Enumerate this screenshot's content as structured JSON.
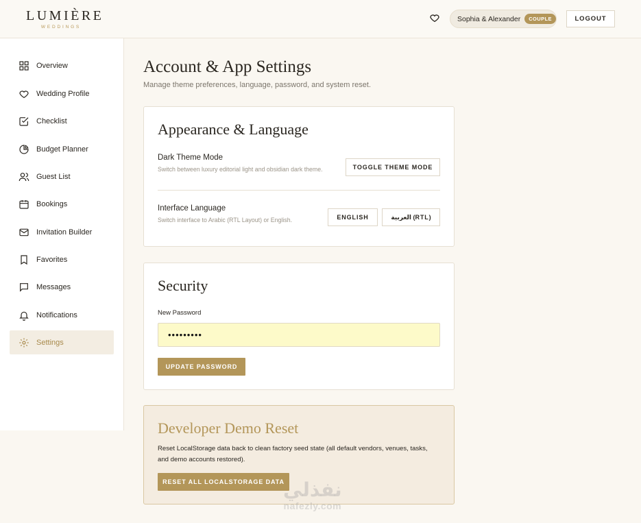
{
  "header": {
    "logo_main": "LUMIÈRE",
    "logo_sub": "WEDDINGS",
    "favorites_icon": "heart-icon",
    "user_name": "Sophia & Alexander",
    "user_badge": "COUPLE",
    "logout_label": "LOGOUT"
  },
  "sidebar": {
    "items": [
      {
        "label": "Overview",
        "icon": "grid-icon"
      },
      {
        "label": "Wedding Profile",
        "icon": "heart-icon"
      },
      {
        "label": "Checklist",
        "icon": "checkbox-icon"
      },
      {
        "label": "Budget Planner",
        "icon": "pie-chart-icon"
      },
      {
        "label": "Guest List",
        "icon": "users-icon"
      },
      {
        "label": "Bookings",
        "icon": "calendar-icon"
      },
      {
        "label": "Invitation Builder",
        "icon": "mail-icon"
      },
      {
        "label": "Favorites",
        "icon": "bookmark-icon"
      },
      {
        "label": "Messages",
        "icon": "message-icon"
      },
      {
        "label": "Notifications",
        "icon": "bell-icon"
      },
      {
        "label": "Settings",
        "icon": "gear-icon",
        "active": true
      }
    ]
  },
  "main": {
    "title": "Account & App Settings",
    "subtitle": "Manage theme preferences, language, password, and system reset.",
    "appearance": {
      "title": "Appearance & Language",
      "theme_label": "Dark Theme Mode",
      "theme_desc": "Switch between luxury editorial light and obsidian dark theme.",
      "theme_button": "TOGGLE THEME MODE",
      "language_label": "Interface Language",
      "language_desc": "Switch interface to Arabic (RTL Layout) or English.",
      "english_button": "ENGLISH",
      "arabic_button": "العربية (RTL)"
    },
    "security": {
      "title": "Security",
      "password_label": "New Password",
      "password_value": "•••••••••",
      "update_button": "UPDATE PASSWORD"
    },
    "developer": {
      "title": "Developer Demo Reset",
      "text": "Reset LocalStorage data back to clean factory seed state (all default vendors, venues, tasks, and demo accounts restored).",
      "reset_button": "RESET ALL LOCALSTORAGE DATA"
    }
  },
  "watermark": {
    "arabic": "نفذلي",
    "latin": "nafezly.com"
  },
  "colors": {
    "accent": "#b39659",
    "background": "#faf7f1",
    "active_nav_bg": "#f3ede2",
    "password_bg": "#fdfac9",
    "developer_bg": "#f4ece0"
  }
}
